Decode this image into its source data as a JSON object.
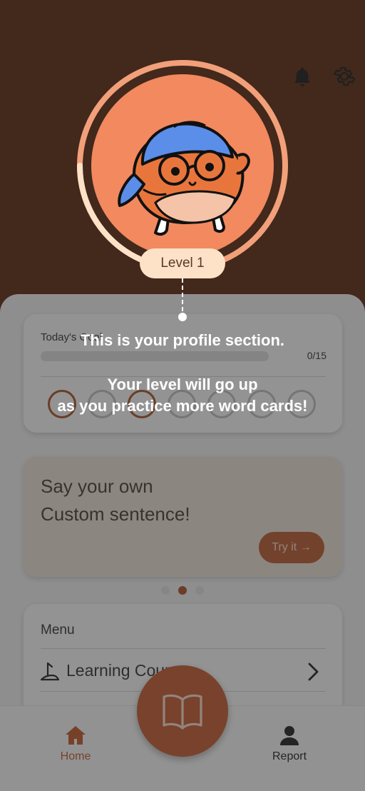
{
  "header": {
    "bell_icon": "bell-icon",
    "settings_icon": "gear-icon"
  },
  "profile": {
    "level_label": "Level 1",
    "progress_fraction": 0.25
  },
  "goal_card": {
    "label": "Today's Goal",
    "count": "0/15",
    "days": [
      {
        "active": true
      },
      {
        "active": false
      },
      {
        "active": true
      },
      {
        "active": false
      },
      {
        "active": false
      },
      {
        "active": false
      },
      {
        "active": false
      }
    ]
  },
  "promo_card": {
    "line1": "Say your own",
    "line2": "Custom sentence!",
    "button_label": "Try it →"
  },
  "carousel": {
    "page_count": 3,
    "active_index": 1
  },
  "menu": {
    "title": "Menu",
    "items": [
      {
        "label": "Learning Course",
        "icon": "learning-course-icon"
      }
    ]
  },
  "bottom_nav": {
    "home_label": "Home",
    "report_label": "Report",
    "fab_icon": "book-icon"
  },
  "tooltip": {
    "line1": "This is your profile section.",
    "line2": "Your level will go up",
    "line3": "as you practice more word cards!"
  },
  "colors": {
    "header_bg": "#5c2a12",
    "accent": "#c45a30",
    "avatar_bg": "#f2895f",
    "level_pill_bg": "#fde2c8"
  }
}
